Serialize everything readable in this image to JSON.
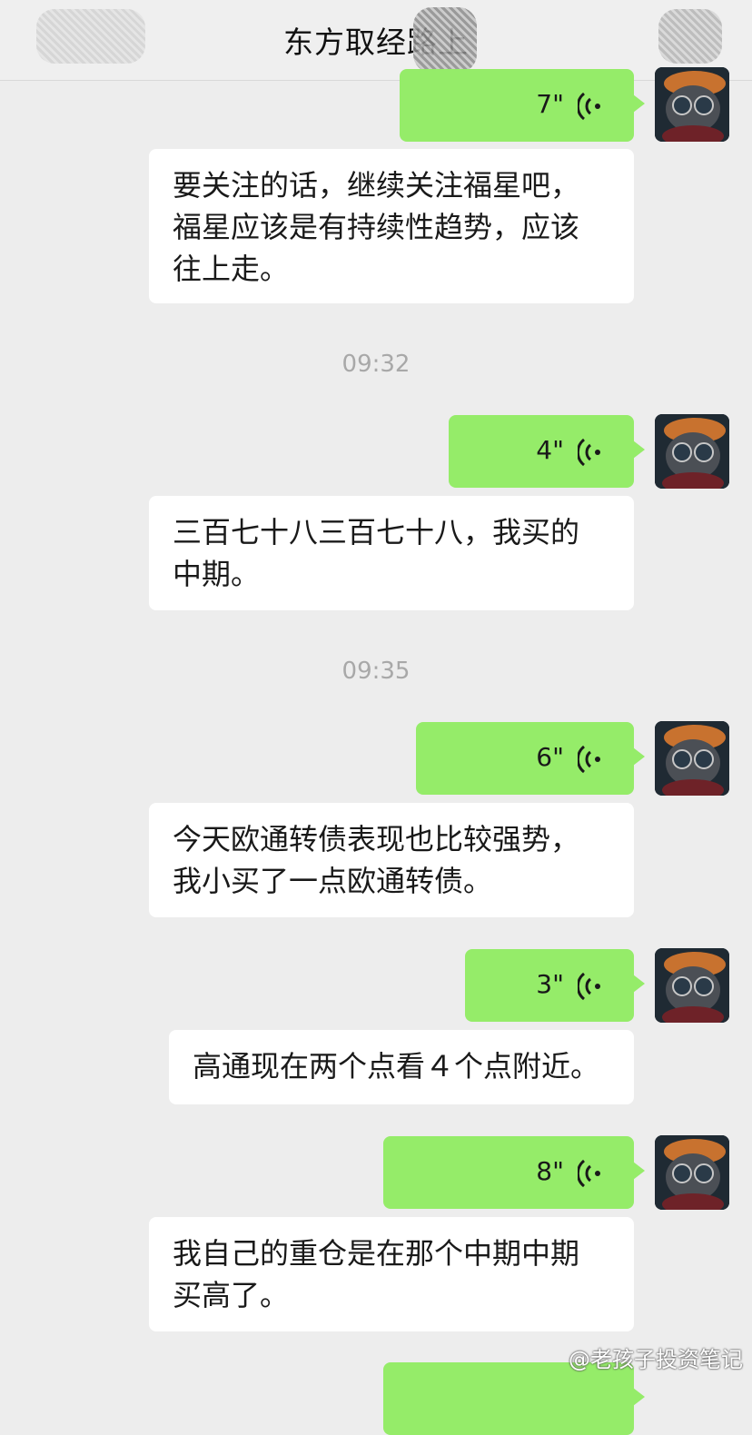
{
  "header": {
    "title": "东方取经路上"
  },
  "messages": [
    {
      "type": "voice",
      "duration": "7\""
    },
    {
      "type": "text",
      "text": "要关注的话，继续关注福星吧，\n福星应该是有持续性趋势，应该\n往上走。"
    },
    {
      "type": "time",
      "text": "09:32"
    },
    {
      "type": "voice",
      "duration": "4\""
    },
    {
      "type": "text",
      "text": "三百七十八三百七十八，我买的\n中期。"
    },
    {
      "type": "time",
      "text": "09:35"
    },
    {
      "type": "voice",
      "duration": "6\""
    },
    {
      "type": "text",
      "text": "今天欧通转债表现也比较强势，\n我小买了一点欧通转债。"
    },
    {
      "type": "voice",
      "duration": "3\""
    },
    {
      "type": "text",
      "text": "高通现在两个点看４个点附近。"
    },
    {
      "type": "voice",
      "duration": "8\""
    },
    {
      "type": "text",
      "text": "我自己的重仓是在那个中期中期\n买高了。"
    }
  ],
  "watermark": "@老孩子投资笔记",
  "colors": {
    "voice_bubble": "#95ec69",
    "text_bubble": "#ffffff",
    "background": "#ededed"
  }
}
